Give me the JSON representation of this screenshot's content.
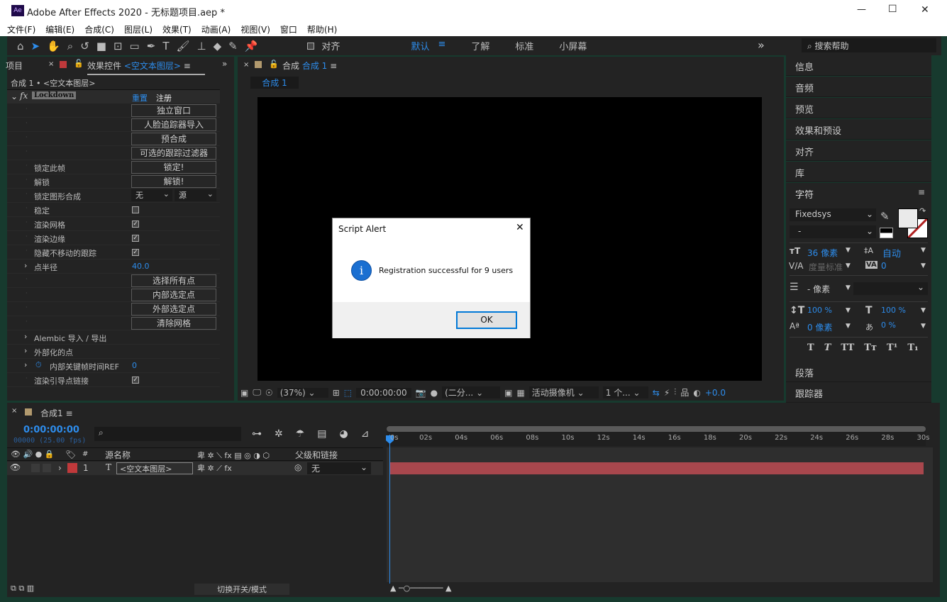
{
  "window": {
    "app_icon": "Ae",
    "title": "Adobe After Effects 2020 - 无标题项目.aep *",
    "min": "—",
    "max": "☐",
    "close": "✕"
  },
  "menu": [
    "文件(F)",
    "编辑(E)",
    "合成(C)",
    "图层(L)",
    "效果(T)",
    "动画(A)",
    "视图(V)",
    "窗口",
    "帮助(H)"
  ],
  "toolbar": {
    "align_label": "对齐",
    "workspaces": [
      "默认",
      "了解",
      "标准",
      "小屏幕"
    ],
    "active_workspace": "默认",
    "search_placeholder": "搜索帮助",
    "more": "»"
  },
  "left_panel": {
    "project_tab": "项目",
    "effects_tab": "效果控件",
    "layer_name": "<空文本图层>",
    "breadcrumb": "合成 1 • <空文本图层>",
    "effect_name": "Lockdown",
    "reset": "重置",
    "register": "注册",
    "rows": [
      {
        "label": "",
        "button": "独立窗口"
      },
      {
        "label": "",
        "button": "人脸追踪器导入"
      },
      {
        "label": "",
        "button": "预合成"
      },
      {
        "label": "",
        "button": "可选的跟踪过滤器"
      },
      {
        "label": "锁定此帧",
        "button": "锁定!"
      },
      {
        "label": "解锁",
        "button": "解锁!"
      },
      {
        "label": "锁定图形合成",
        "select1": "无",
        "select2": "源"
      },
      {
        "label": "稳定",
        "checkbox": false
      },
      {
        "label": "渲染网格",
        "checkbox": true
      },
      {
        "label": "渲染边缘",
        "checkbox": true
      },
      {
        "label": "隐藏不移动的跟踪",
        "checkbox": true
      },
      {
        "label": "点半径",
        "value": "40.0",
        "expand": true
      },
      {
        "label": "",
        "button": "选择所有点"
      },
      {
        "label": "",
        "button": "内部选定点"
      },
      {
        "label": "",
        "button": "外部选定点"
      },
      {
        "label": "",
        "button": "清除网格"
      },
      {
        "label": "Alembic 导入 / 导出",
        "expand": true
      },
      {
        "label": "外部化的点",
        "expand": true
      },
      {
        "label": "内部关键帧时间REF",
        "value": "0",
        "expand": true,
        "stopwatch": true
      },
      {
        "label": "渲染引导点链接",
        "checkbox": true
      }
    ]
  },
  "viewer": {
    "tab": "合成",
    "comp_name": "合成 1",
    "subtab": "合成 1",
    "zoom": "(37%)",
    "timecode": "0:00:00:00",
    "resolution": "(二分...",
    "camera": "活动摄像机",
    "views": "1 个...",
    "exposure": "+0.0"
  },
  "dialog": {
    "title": "Script Alert",
    "message": "Registration successful for 9 users",
    "ok": "OK",
    "icon": "info-icon"
  },
  "right_panel": {
    "items": [
      "信息",
      "音频",
      "预览",
      "效果和预设",
      "对齐",
      "库"
    ],
    "character_title": "字符",
    "font": "Fixedsys",
    "style": "-",
    "size": "36 像素",
    "leading": "自动",
    "kerning": "度量标准",
    "tracking": "0",
    "stroke": "- 像素",
    "vscale": "100 %",
    "hscale": "100 %",
    "baseline": "0 像素",
    "tsume": "0 %",
    "styles": [
      "T",
      "T",
      "TT",
      "Tт",
      "T¹",
      "T₁"
    ],
    "paragraph": "段落",
    "tracker": "跟踪器"
  },
  "timeline": {
    "comp_tab": "合成1",
    "timecode": "0:00:00:00",
    "fps": "00000 (25.00 fps)",
    "search_placeholder": "",
    "col_num": "#",
    "col_source": "源名称",
    "col_parent": "父级和链接",
    "layer": {
      "num": "1",
      "type": "T",
      "name": "<空文本图层>",
      "parent": "无",
      "label_color": "#c0393b"
    },
    "ticks": [
      "0s",
      "02s",
      "04s",
      "06s",
      "08s",
      "10s",
      "12s",
      "14s",
      "16s",
      "18s",
      "20s",
      "22s",
      "24s",
      "26s",
      "28s",
      "30s"
    ],
    "toggle_label": "切换开关/模式"
  },
  "colors": {
    "accent": "#2d8ceb",
    "bar": "#a8474d",
    "panel": "#232323"
  }
}
